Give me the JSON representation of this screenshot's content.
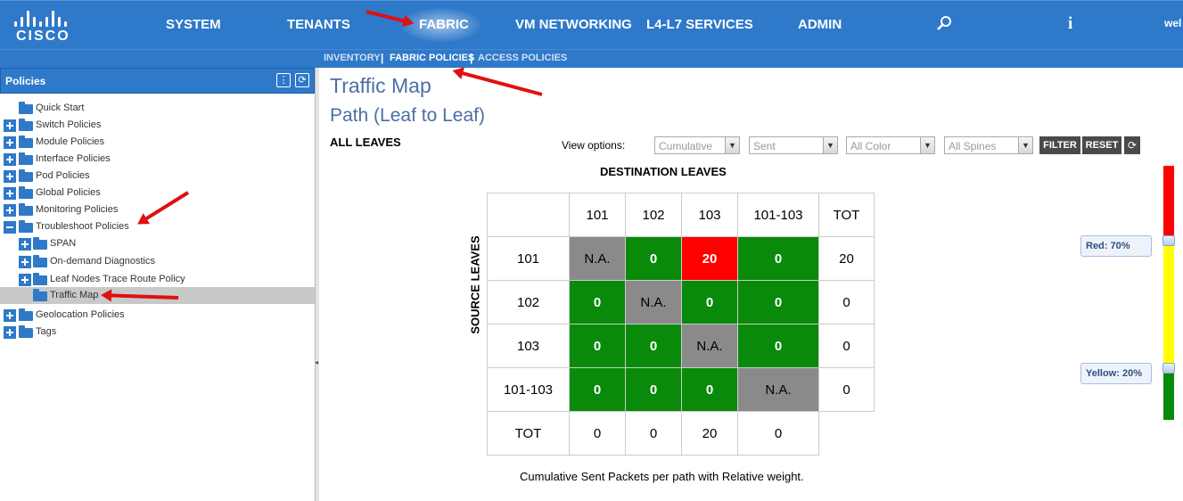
{
  "colors": {
    "nav_bg": "#2e79c9",
    "green": "#0a8a0a",
    "red": "#ff0000",
    "gray": "#8a8a8a",
    "yellow": "#ffff00"
  },
  "logo": {
    "text": "CISCO"
  },
  "nav": {
    "system": "SYSTEM",
    "tenants": "TENANTS",
    "fabric": "FABRIC",
    "vm_networking": "VM NETWORKING",
    "l4l7": "L4-L7 SERVICES",
    "admin": "ADMIN",
    "search_icon": "search-icon",
    "info_icon": "info-icon",
    "user": "wel"
  },
  "subnav": {
    "inventory": "INVENTORY",
    "fabric_policies": "FABRIC POLICIES",
    "access_policies": "ACCESS POLICIES",
    "separator": "|"
  },
  "sidebar": {
    "title": "Policies",
    "items": [
      {
        "label": "Quick Start"
      },
      {
        "label": "Switch Policies"
      },
      {
        "label": "Module Policies"
      },
      {
        "label": "Interface Policies"
      },
      {
        "label": "Pod Policies"
      },
      {
        "label": "Global Policies"
      },
      {
        "label": "Monitoring Policies"
      },
      {
        "label": "Troubleshoot Policies"
      },
      {
        "label": "SPAN"
      },
      {
        "label": "On-demand Diagnostics"
      },
      {
        "label": "Leaf Nodes Trace Route Policy"
      },
      {
        "label": "Traffic Map"
      },
      {
        "label": "Geolocation Policies"
      },
      {
        "label": "Tags"
      }
    ]
  },
  "main": {
    "title": "Traffic Map",
    "subtitle": "Path (Leaf to Leaf)",
    "all_leaves": "ALL LEAVES",
    "view_options": "View options:",
    "dropdowns": {
      "mode": "Cumulative",
      "direction": "Sent",
      "color": "All Color",
      "spines": "All Spines"
    },
    "filter": "FILTER",
    "reset": "RESET",
    "dest_title": "DESTINATION LEAVES",
    "src_title": "SOURCE LEAVES",
    "caption": "Cumulative Sent Packets per path with Relative weight."
  },
  "matrix": {
    "columns": [
      "101",
      "102",
      "103",
      "101-103",
      "TOT"
    ],
    "rows": [
      {
        "label": "101",
        "cells": [
          "N.A.",
          "0",
          "20",
          "0",
          "20"
        ]
      },
      {
        "label": "102",
        "cells": [
          "0",
          "N.A.",
          "0",
          "0",
          "0"
        ]
      },
      {
        "label": "103",
        "cells": [
          "0",
          "0",
          "N.A.",
          "0",
          "0"
        ]
      },
      {
        "label": "101-103",
        "cells": [
          "0",
          "0",
          "0",
          "N.A.",
          "0"
        ]
      }
    ],
    "totals": {
      "label": "TOT",
      "cells": [
        "0",
        "0",
        "20",
        "0"
      ]
    }
  },
  "legend": {
    "red": "Red: 70%",
    "yellow": "Yellow: 20%"
  }
}
